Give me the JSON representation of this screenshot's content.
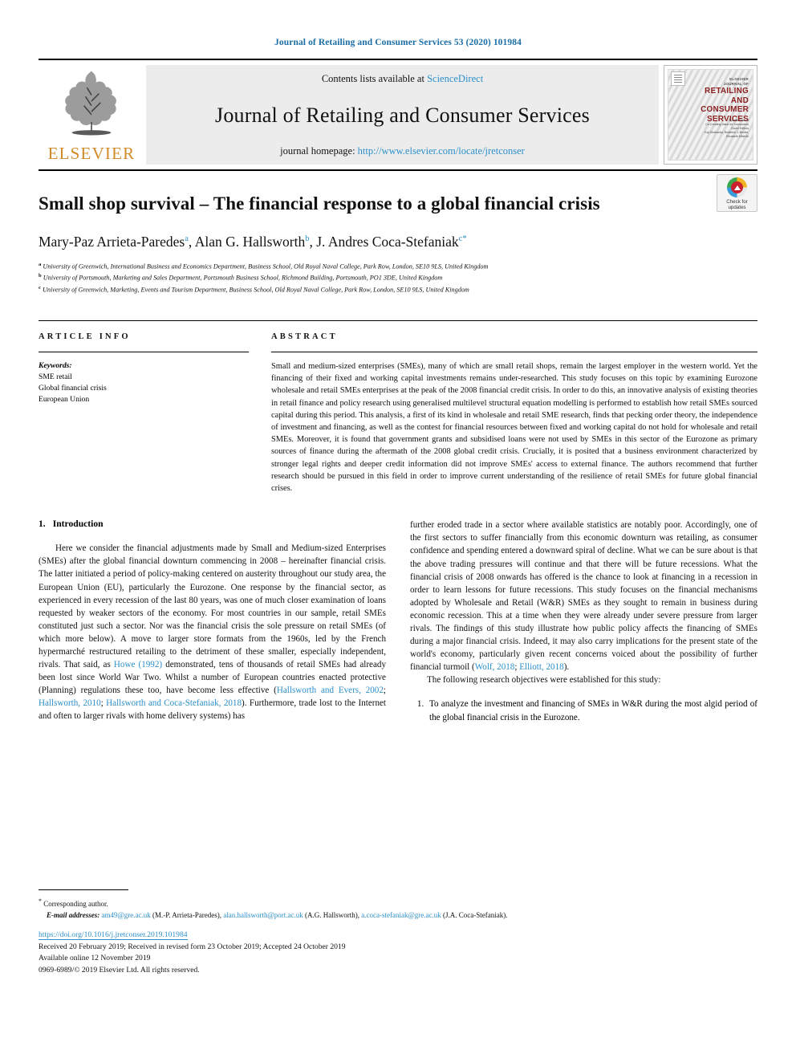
{
  "running_head": "Journal of Retailing and Consumer Services 53 (2020) 101984",
  "masthead": {
    "publisher": "ELSEVIER",
    "contents_prefix": "Contents lists available at ",
    "contents_link": "ScienceDirect",
    "journal_name": "Journal of Retailing and Consumer Services",
    "homepage_prefix": "journal homepage: ",
    "homepage_link": "http://www.elsevier.com/locate/jretconser",
    "cover": {
      "tiny_top": "ELSEVIER",
      "line0": "JOURNAL OF",
      "line1": "RETAILING",
      "line2": "AND",
      "line3": "CONSUMER",
      "line4": "SERVICES",
      "sub1": "Special Section",
      "sub2": "Co-Creating Value for Consumers",
      "sub3": "Guest Editors",
      "sub4": "Kaj Storbacka, Roderick J. Brodie,",
      "sub5": "Elizabeth Mitchell"
    }
  },
  "crossmark": {
    "label_line1": "Check for",
    "label_line2": "updates"
  },
  "article": {
    "title": "Small shop survival – The financial response to a global financial crisis",
    "authors": [
      {
        "name": "Mary-Paz Arrieta-Paredes",
        "marks": "a",
        "star": false
      },
      {
        "name": "Alan G. Hallsworth",
        "marks": "b",
        "star": false
      },
      {
        "name": "J. Andres Coca-Stefaniak",
        "marks": "c",
        "star": true
      }
    ],
    "affiliations": [
      {
        "mark": "a",
        "text": "University of Greenwich, International Business and Economics Department, Business School, Old Royal Naval College, Park Row, London, SE10 9LS, United Kingdom"
      },
      {
        "mark": "b",
        "text": "University of Portsmouth, Marketing and Sales Department, Portsmouth Business School, Richmond Building, Portsmouth, PO1 3DE, United Kingdom"
      },
      {
        "mark": "c",
        "text": "University of Greenwich, Marketing, Events and Tourism Department, Business School, Old Royal Naval College, Park Row, London, SE10 9LS, United Kingdom"
      }
    ]
  },
  "article_info": {
    "heading": "ARTICLE INFO",
    "keywords_label": "Keywords:",
    "keywords": [
      "SME retail",
      "Global financial crisis",
      "European Union"
    ]
  },
  "abstract": {
    "heading": "ABSTRACT",
    "text": "Small and medium-sized enterprises (SMEs), many of which are small retail shops, remain the largest employer in the western world. Yet the financing of their fixed and working capital investments remains under-researched. This study focuses on this topic by examining Eurozone wholesale and retail SMEs enterprises at the peak of the 2008 financial credit crisis. In order to do this, an innovative analysis of existing theories in retail finance and policy research using generalised multilevel structural equation modelling is performed to establish how retail SMEs sourced capital during this period. This analysis, a first of its kind in wholesale and retail SME research, finds that pecking order theory, the independence of investment and financing, as well as the contest for financial resources between fixed and working capital do not hold for wholesale and retail SMEs. Moreover, it is found that government grants and subsidised loans were not used by SMEs in this sector of the Eurozone as primary sources of finance during the aftermath of the 2008 global credit crisis. Crucially, it is posited that a business environment characterized by stronger legal rights and deeper credit information did not improve SMEs' access to external finance. The authors recommend that further research should be pursued in this field in order to improve current understanding of the resilience of retail SMEs for future global financial crises."
  },
  "introduction": {
    "number": "1.",
    "heading": "Introduction",
    "left_para_1": "Here we consider the financial adjustments made by Small and Medium-sized Enterprises (SMEs) after the global financial downturn commencing in 2008 – hereinafter financial crisis. The latter initiated a period of policy-making centered on austerity throughout our study area, the European Union (EU), particularly the Eurozone. One response by the financial sector, as experienced in every recession of the last 80 years, was one of much closer examination of loans requested by weaker sectors of the economy. For most countries in our sample, retail SMEs constituted just such a sector. Nor was the financial crisis the sole pressure on retail SMEs (of which more below). A move to larger store formats from the 1960s, led by the French hypermarché restructured retailing to the detriment of these smaller, especially independent, rivals. That said, as ",
    "ref_howe": "Howe (1992)",
    "left_para_1b": " demonstrated, tens of thousands of retail SMEs had already been lost since World War Two. Whilst a number of European countries enacted protective (Planning) regulations these too, have become less effective (",
    "ref_hallsworth_evers": "Hallsworth and Evers, 2002",
    "ref_sep1": "; ",
    "ref_hallsworth_2010": "Hallsworth, 2010",
    "ref_sep2": "; ",
    "ref_hallsworth_coca": "Hallsworth and Coca-Stefaniak, 2018",
    "left_para_1c": "). Furthermore, trade lost to the Internet and often to larger rivals with home delivery systems) has",
    "right_para_1": "further eroded trade in a sector where available statistics are notably poor. Accordingly, one of the first sectors to suffer financially from this economic downturn was retailing, as consumer confidence and spending entered a downward spiral of decline. What we can be sure about is that the above trading pressures will continue and that there will be future recessions. What the financial crisis of 2008 onwards has offered is the chance to look at financing in a recession in order to learn lessons for future recessions. This study focuses on the financial mechanisms adopted by Wholesale and Retail (W&R) SMEs as they sought to remain in business during economic recession. This at a time when they were already under severe pressure from larger rivals. The findings of this study illustrate how public policy affects the financing of SMEs during a major financial crisis. Indeed, it may also carry implications for the present state of the world's economy, particularly given recent concerns voiced about the possibility of further financial turmoil (",
    "ref_wolf": "Wolf, 2018",
    "ref_sep3": "; ",
    "ref_elliott": "Elliott, 2018",
    "right_para_1b": ").",
    "right_para_2": "The following research objectives were established for this study:",
    "objectives": [
      "To analyze the investment and financing of SMEs in W&R during the most algid period of the global financial crisis in the Eurozone."
    ]
  },
  "footnotes": {
    "corresponding_mark": "*",
    "corresponding_text": "Corresponding author.",
    "email_label": "E-mail addresses:",
    "emails": [
      {
        "address": "am49@gre.ac.uk",
        "owner": "(M.-P. Arrieta-Paredes)"
      },
      {
        "address": "alan.hallsworth@port.ac.uk",
        "owner": "(A.G. Hallsworth)"
      },
      {
        "address": "a.coca-stefaniak@gre.ac.uk",
        "owner": "(J.A. Coca-Stefaniak)."
      }
    ]
  },
  "publication": {
    "doi": "https://doi.org/10.1016/j.jretconser.2019.101984",
    "dates": "Received 20 February 2019; Received in revised form 23 October 2019; Accepted 24 October 2019",
    "available": "Available online 12 November 2019",
    "copyright": "0969-6989/© 2019 Elsevier Ltd. All rights reserved."
  }
}
